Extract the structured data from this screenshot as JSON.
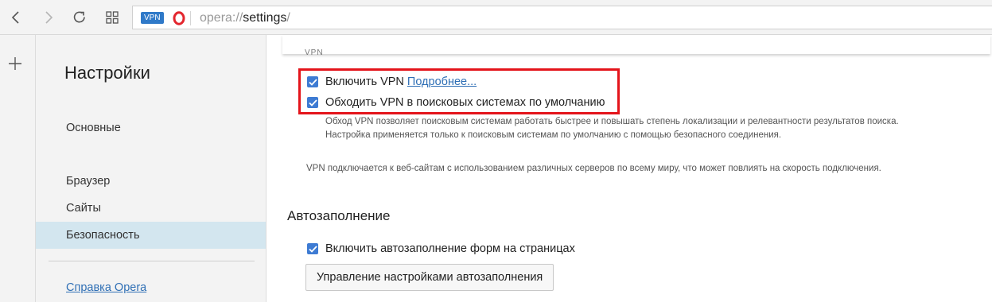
{
  "browser": {
    "vpn_badge": "VPN",
    "url_scheme": "opera://",
    "url_host": "settings",
    "url_suffix": "/"
  },
  "sidebar": {
    "title": "Настройки",
    "items": [
      {
        "label": "Основные"
      },
      {
        "label": "Браузер"
      },
      {
        "label": "Сайты"
      },
      {
        "label": "Безопасность",
        "active": true
      }
    ],
    "help_link": "Справка Opera"
  },
  "vpn": {
    "section_title_partial": "VPN",
    "enable_label": "Включить VPN",
    "enable_checked": true,
    "more_link": "Подробнее...",
    "bypass_label": "Обходить VPN в поисковых системах по умолчанию",
    "bypass_checked": true,
    "bypass_desc_line1": "Обход VPN позволяет поисковым системам работать быстрее и повышать степень локализации и релевантности результатов поиска.",
    "bypass_desc_line2": "Настройка применяется только к поисковым системам по умолчанию с помощью безопасного соединения.",
    "note": "VPN подключается к веб-сайтам с использованием различных серверов по всему миру, что может повлиять на скорость подключения."
  },
  "autofill": {
    "title": "Автозаполнение",
    "enable_label": "Включить автозаполнение форм на страницах",
    "enable_checked": true,
    "manage_button": "Управление настройками автозаполнения"
  },
  "colors": {
    "highlight_border": "#e4141b",
    "checkbox": "#3d7bd3",
    "active_item_bg": "#d3e6ef",
    "link": "#2f6fb5",
    "vpn_badge_bg": "#2f79c8"
  }
}
